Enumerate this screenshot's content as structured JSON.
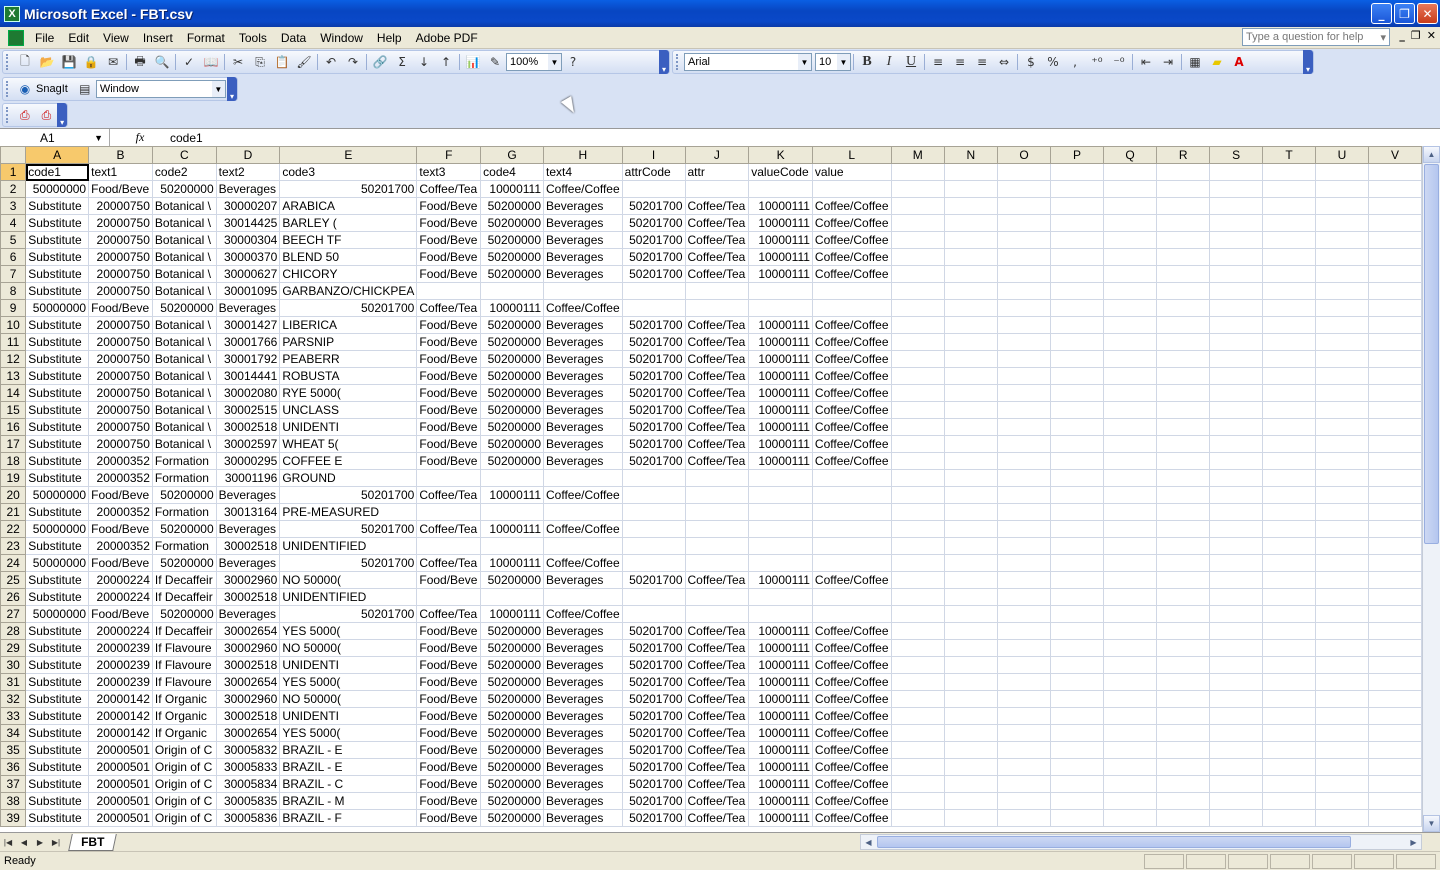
{
  "window": {
    "title": "Microsoft Excel - FBT.csv"
  },
  "menu": [
    "File",
    "Edit",
    "View",
    "Insert",
    "Format",
    "Tools",
    "Data",
    "Window",
    "Help",
    "Adobe PDF"
  ],
  "help_placeholder": "Type a question for help",
  "toolbar": {
    "zoom": "100%",
    "font_name": "Arial",
    "font_size": "10",
    "bold": "B",
    "italic": "I",
    "underline": "U",
    "currency": "$",
    "percent": "%",
    "comma": ","
  },
  "snagit": {
    "label": "SnagIt",
    "capture_mode": "Window"
  },
  "formula_bar": {
    "name_box": "A1",
    "fx": "fx",
    "formula": "code1"
  },
  "columns": [
    "A",
    "B",
    "C",
    "D",
    "E",
    "F",
    "G",
    "H",
    "I",
    "J",
    "K",
    "L",
    "M",
    "N",
    "O",
    "P",
    "Q",
    "R",
    "S",
    "T",
    "U",
    "V"
  ],
  "rows": [
    [
      "code1",
      "text1",
      "code2",
      "text2",
      "code3",
      "text3",
      "code4",
      "text4",
      "attrCode",
      "attr",
      "valueCode",
      "value"
    ],
    [
      "50000000",
      "Food/Beve",
      "50200000",
      "Beverages",
      "50201700",
      "Coffee/Tea",
      "10000111",
      "Coffee/Coffee"
    ],
    [
      "Substitute",
      "20000750",
      "Botanical \\",
      "30000207",
      "ARABICA",
      "Food/Beve",
      "50200000",
      "Beverages",
      "50201700",
      "Coffee/Tea",
      "10000111",
      "Coffee/Coffee"
    ],
    [
      "Substitute",
      "20000750",
      "Botanical \\",
      "30014425",
      "BARLEY (",
      "Food/Beve",
      "50200000",
      "Beverages",
      "50201700",
      "Coffee/Tea",
      "10000111",
      "Coffee/Coffee"
    ],
    [
      "Substitute",
      "20000750",
      "Botanical \\",
      "30000304",
      "BEECH TF",
      "Food/Beve",
      "50200000",
      "Beverages",
      "50201700",
      "Coffee/Tea",
      "10000111",
      "Coffee/Coffee"
    ],
    [
      "Substitute",
      "20000750",
      "Botanical \\",
      "30000370",
      "BLEND 50",
      "Food/Beve",
      "50200000",
      "Beverages",
      "50201700",
      "Coffee/Tea",
      "10000111",
      "Coffee/Coffee"
    ],
    [
      "Substitute",
      "20000750",
      "Botanical \\",
      "30000627",
      "CHICORY",
      "Food/Beve",
      "50200000",
      "Beverages",
      "50201700",
      "Coffee/Tea",
      "10000111",
      "Coffee/Coffee"
    ],
    [
      "Substitute",
      "20000750",
      "Botanical \\",
      "30001095",
      "GARBANZO/CHICKPEA"
    ],
    [
      "50000000",
      "Food/Beve",
      "50200000",
      "Beverages",
      "50201700",
      "Coffee/Tea",
      "10000111",
      "Coffee/Coffee"
    ],
    [
      "Substitute",
      "20000750",
      "Botanical \\",
      "30001427",
      "LIBERICA",
      "Food/Beve",
      "50200000",
      "Beverages",
      "50201700",
      "Coffee/Tea",
      "10000111",
      "Coffee/Coffee"
    ],
    [
      "Substitute",
      "20000750",
      "Botanical \\",
      "30001766",
      "PARSNIP",
      "Food/Beve",
      "50200000",
      "Beverages",
      "50201700",
      "Coffee/Tea",
      "10000111",
      "Coffee/Coffee"
    ],
    [
      "Substitute",
      "20000750",
      "Botanical \\",
      "30001792",
      "PEABERR",
      "Food/Beve",
      "50200000",
      "Beverages",
      "50201700",
      "Coffee/Tea",
      "10000111",
      "Coffee/Coffee"
    ],
    [
      "Substitute",
      "20000750",
      "Botanical \\",
      "30014441",
      "ROBUSTA",
      "Food/Beve",
      "50200000",
      "Beverages",
      "50201700",
      "Coffee/Tea",
      "10000111",
      "Coffee/Coffee"
    ],
    [
      "Substitute",
      "20000750",
      "Botanical \\",
      "30002080",
      "RYE 5000(",
      "Food/Beve",
      "50200000",
      "Beverages",
      "50201700",
      "Coffee/Tea",
      "10000111",
      "Coffee/Coffee"
    ],
    [
      "Substitute",
      "20000750",
      "Botanical \\",
      "30002515",
      "UNCLASS",
      "Food/Beve",
      "50200000",
      "Beverages",
      "50201700",
      "Coffee/Tea",
      "10000111",
      "Coffee/Coffee"
    ],
    [
      "Substitute",
      "20000750",
      "Botanical \\",
      "30002518",
      "UNIDENTI",
      "Food/Beve",
      "50200000",
      "Beverages",
      "50201700",
      "Coffee/Tea",
      "10000111",
      "Coffee/Coffee"
    ],
    [
      "Substitute",
      "20000750",
      "Botanical \\",
      "30002597",
      "WHEAT 5(",
      "Food/Beve",
      "50200000",
      "Beverages",
      "50201700",
      "Coffee/Tea",
      "10000111",
      "Coffee/Coffee"
    ],
    [
      "Substitute",
      "20000352",
      "Formation",
      "30000295",
      "COFFEE E",
      "Food/Beve",
      "50200000",
      "Beverages",
      "50201700",
      "Coffee/Tea",
      "10000111",
      "Coffee/Coffee"
    ],
    [
      "Substitute",
      "20000352",
      "Formation",
      "30001196",
      "GROUND"
    ],
    [
      "50000000",
      "Food/Beve",
      "50200000",
      "Beverages",
      "50201700",
      "Coffee/Tea",
      "10000111",
      "Coffee/Coffee"
    ],
    [
      "Substitute",
      "20000352",
      "Formation",
      "30013164",
      "PRE-MEASURED"
    ],
    [
      "50000000",
      "Food/Beve",
      "50200000",
      "Beverages",
      "50201700",
      "Coffee/Tea",
      "10000111",
      "Coffee/Coffee"
    ],
    [
      "Substitute",
      "20000352",
      "Formation",
      "30002518",
      "UNIDENTIFIED"
    ],
    [
      "50000000",
      "Food/Beve",
      "50200000",
      "Beverages",
      "50201700",
      "Coffee/Tea",
      "10000111",
      "Coffee/Coffee"
    ],
    [
      "Substitute",
      "20000224",
      "If Decaffeir",
      "30002960",
      "NO 50000(",
      "Food/Beve",
      "50200000",
      "Beverages",
      "50201700",
      "Coffee/Tea",
      "10000111",
      "Coffee/Coffee"
    ],
    [
      "Substitute",
      "20000224",
      "If Decaffeir",
      "30002518",
      "UNIDENTIFIED"
    ],
    [
      "50000000",
      "Food/Beve",
      "50200000",
      "Beverages",
      "50201700",
      "Coffee/Tea",
      "10000111",
      "Coffee/Coffee"
    ],
    [
      "Substitute",
      "20000224",
      "If Decaffeir",
      "30002654",
      "YES 5000(",
      "Food/Beve",
      "50200000",
      "Beverages",
      "50201700",
      "Coffee/Tea",
      "10000111",
      "Coffee/Coffee"
    ],
    [
      "Substitute",
      "20000239",
      "If Flavoure",
      "30002960",
      "NO 50000(",
      "Food/Beve",
      "50200000",
      "Beverages",
      "50201700",
      "Coffee/Tea",
      "10000111",
      "Coffee/Coffee"
    ],
    [
      "Substitute",
      "20000239",
      "If Flavoure",
      "30002518",
      "UNIDENTI",
      "Food/Beve",
      "50200000",
      "Beverages",
      "50201700",
      "Coffee/Tea",
      "10000111",
      "Coffee/Coffee"
    ],
    [
      "Substitute",
      "20000239",
      "If Flavoure",
      "30002654",
      "YES 5000(",
      "Food/Beve",
      "50200000",
      "Beverages",
      "50201700",
      "Coffee/Tea",
      "10000111",
      "Coffee/Coffee"
    ],
    [
      "Substitute",
      "20000142",
      "If Organic",
      "30002960",
      "NO 50000(",
      "Food/Beve",
      "50200000",
      "Beverages",
      "50201700",
      "Coffee/Tea",
      "10000111",
      "Coffee/Coffee"
    ],
    [
      "Substitute",
      "20000142",
      "If Organic",
      "30002518",
      "UNIDENTI",
      "Food/Beve",
      "50200000",
      "Beverages",
      "50201700",
      "Coffee/Tea",
      "10000111",
      "Coffee/Coffee"
    ],
    [
      "Substitute",
      "20000142",
      "If Organic",
      "30002654",
      "YES 5000(",
      "Food/Beve",
      "50200000",
      "Beverages",
      "50201700",
      "Coffee/Tea",
      "10000111",
      "Coffee/Coffee"
    ],
    [
      "Substitute",
      "20000501",
      "Origin of C",
      "30005832",
      "BRAZIL - E",
      "Food/Beve",
      "50200000",
      "Beverages",
      "50201700",
      "Coffee/Tea",
      "10000111",
      "Coffee/Coffee"
    ],
    [
      "Substitute",
      "20000501",
      "Origin of C",
      "30005833",
      "BRAZIL - E",
      "Food/Beve",
      "50200000",
      "Beverages",
      "50201700",
      "Coffee/Tea",
      "10000111",
      "Coffee/Coffee"
    ],
    [
      "Substitute",
      "20000501",
      "Origin of C",
      "30005834",
      "BRAZIL - C",
      "Food/Beve",
      "50200000",
      "Beverages",
      "50201700",
      "Coffee/Tea",
      "10000111",
      "Coffee/Coffee"
    ],
    [
      "Substitute",
      "20000501",
      "Origin of C",
      "30005835",
      "BRAZIL - M",
      "Food/Beve",
      "50200000",
      "Beverages",
      "50201700",
      "Coffee/Tea",
      "10000111",
      "Coffee/Coffee"
    ],
    [
      "Substitute",
      "20000501",
      "Origin of C",
      "30005836",
      "BRAZIL - F",
      "Food/Beve",
      "50200000",
      "Beverages",
      "50201700",
      "Coffee/Tea",
      "10000111",
      "Coffee/Coffee"
    ]
  ],
  "sheet_tab": "FBT",
  "status": "Ready"
}
